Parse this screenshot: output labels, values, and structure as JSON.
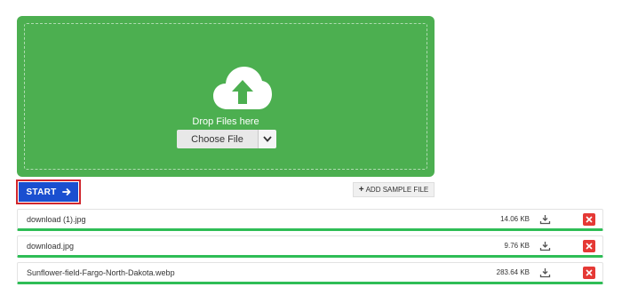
{
  "dropzone": {
    "label": "Drop Files here",
    "choose_file_label": "Choose File",
    "background_color": "#4caf50",
    "icon": "cloud-upload-icon"
  },
  "actions": {
    "start_label": "START",
    "start_color": "#1a4fd0",
    "add_sample_label": "ADD SAMPLE FILE"
  },
  "files": [
    {
      "name": "download (1).jpg",
      "size": "14.06 KB"
    },
    {
      "name": "download.jpg",
      "size": "9.76 KB"
    },
    {
      "name": "Sunflower-field-Fargo-North-Dakota.webp",
      "size": "283.64 KB"
    }
  ],
  "colors": {
    "progress_complete": "#2ebd56",
    "delete": "#e53935",
    "highlight": "#d0262d"
  }
}
